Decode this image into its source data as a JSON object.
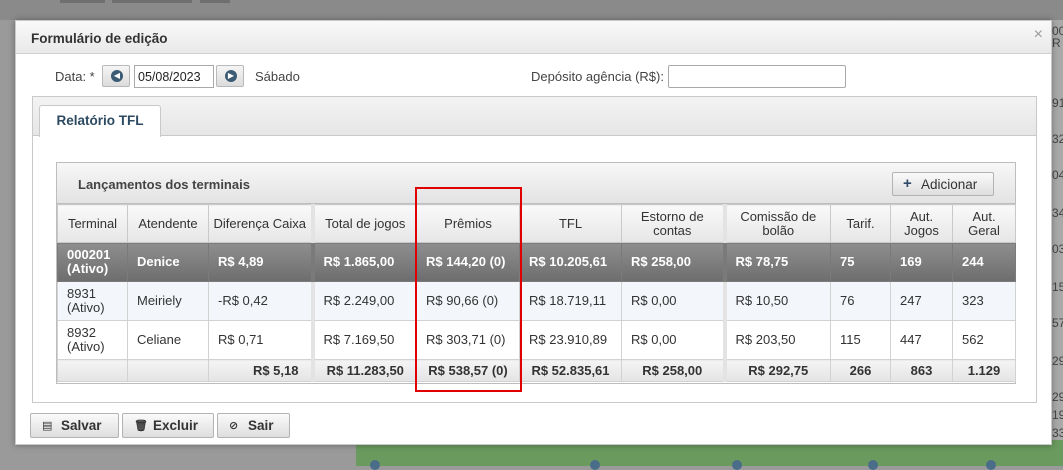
{
  "modal": {
    "title": "Formulário de edição",
    "close_glyph": "×"
  },
  "form": {
    "date_label": "Data: *",
    "date_value": "05/08/2023",
    "weekday": "Sábado",
    "deposit_label": "Depósito agência (R$):",
    "deposit_value": "",
    "prev_icon": "chevron-left-icon",
    "next_icon": "chevron-right-icon"
  },
  "tabs": [
    {
      "label": "Relatório TFL",
      "active": true
    }
  ],
  "grid": {
    "title": "Lançamentos dos terminais",
    "add_label": "Adicionar",
    "headers": [
      "Terminal",
      "Atendente",
      "Diferença Caixa",
      "Total de jogos",
      "Prêmios",
      "TFL",
      "Estorno de contas",
      "Comissão de bolão",
      "Tarif.",
      "Aut. Jogos",
      "Aut. Geral"
    ],
    "rows": [
      {
        "terminal": "000201 (Ativo)",
        "atendente": "Denice",
        "diferenca": "R$ 4,89",
        "total": "R$ 1.865,00",
        "premios": "R$ 144,20 (0)",
        "tfl": "R$ 10.205,61",
        "estorno": "R$ 258,00",
        "comissao": "R$ 78,75",
        "tarif": "75",
        "aut_jogos": "169",
        "aut_geral": "244",
        "selected": true
      },
      {
        "terminal": "8931 (Ativo)",
        "atendente": "Meiriely",
        "diferenca": "-R$ 0,42",
        "total": "R$ 2.249,00",
        "premios": "R$ 90,66 (0)",
        "tfl": "R$ 18.719,11",
        "estorno": "R$ 0,00",
        "comissao": "R$ 10,50",
        "tarif": "76",
        "aut_jogos": "247",
        "aut_geral": "323",
        "selected": false
      },
      {
        "terminal": "8932 (Ativo)",
        "atendente": "Celiane",
        "diferenca": "R$ 0,71",
        "total": "R$ 7.169,50",
        "premios": "R$ 303,71 (0)",
        "tfl": "R$ 23.910,89",
        "estorno": "R$ 0,00",
        "comissao": "R$ 203,50",
        "tarif": "115",
        "aut_jogos": "447",
        "aut_geral": "562",
        "selected": false
      }
    ],
    "totals": {
      "diferenca": "R$ 5,18",
      "total": "R$ 11.283,50",
      "premios": "R$ 538,57 (0)",
      "tfl": "R$ 52.835,61",
      "estorno": "R$ 258,00",
      "comissao": "R$ 292,75",
      "tarif": "266",
      "aut_jogos": "863",
      "aut_geral": "1.129"
    }
  },
  "footer": {
    "save_label": "Salvar",
    "delete_label": "Excluir",
    "exit_label": "Sair"
  },
  "background": {
    "right_col_fragments": [
      "00",
      "R",
      "91",
      "32",
      "04",
      "34",
      "03",
      "15",
      "57",
      "29",
      "29",
      "19",
      "33"
    ]
  },
  "colors": {
    "highlight": "#e00000",
    "selected_row": "#7a7a7a",
    "accent": "#2b4a62"
  }
}
